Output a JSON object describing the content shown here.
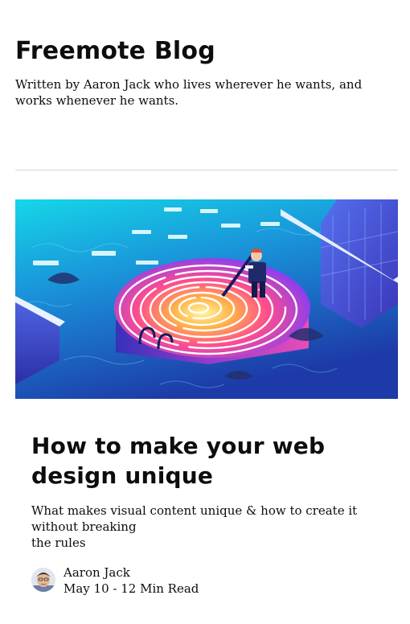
{
  "blog": {
    "title": "Freemote Blog",
    "description": "Written by Aaron Jack who lives wherever he wants, and works whenever he wants."
  },
  "post": {
    "image_icon": "fingerprint-illustration",
    "title": "How to make your web design unique",
    "excerpt_lines": [
      "What makes visual content unique & how to create it",
      "without breaking",
      "the rules"
    ],
    "author": "Aaron Jack",
    "date": "May 10",
    "separator": "-",
    "read_time": "12 Min Read",
    "meta": "May 10 - 12 Min Read"
  }
}
